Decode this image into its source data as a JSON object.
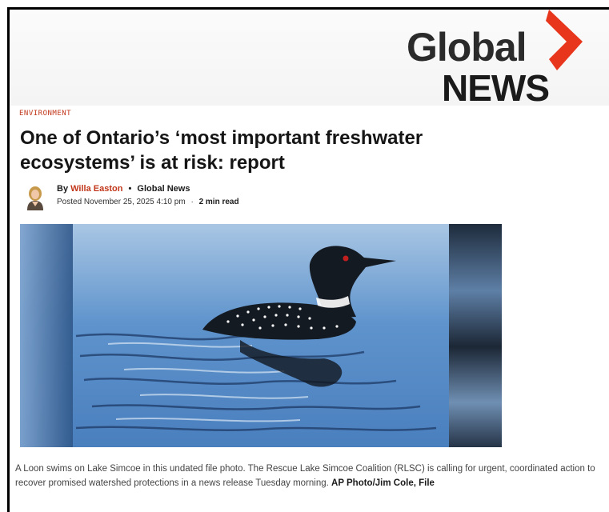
{
  "brand": {
    "logo_line1": "Global",
    "logo_line2": "NEWS",
    "accent_color": "#e8361c"
  },
  "article": {
    "category": "ENVIRONMENT",
    "title": "One of Ontario’s ‘most important freshwater ecosystems’ is at risk: report",
    "byline": {
      "prefix": "By",
      "author": "Willa Easton",
      "separator": "•",
      "outlet": "Global News"
    },
    "dateline": {
      "posted": "Posted November 25, 2025 4:10 pm",
      "separator": "·",
      "read_time": "2 min read"
    },
    "image": {
      "icon": "loon-photo"
    },
    "caption": {
      "text": "A Loon swims on Lake Simcoe in this undated file photo. The Rescue Lake Simcoe Coalition (RLSC) is calling for urgent, coordinated action to recover promised watershed protections in a news release Tuesday morning.",
      "credit": "AP Photo/Jim Cole, File"
    }
  },
  "colors": {
    "category": "#c2371b",
    "author": "#c2371b",
    "title": "#151515",
    "water": "#4f86c6"
  }
}
